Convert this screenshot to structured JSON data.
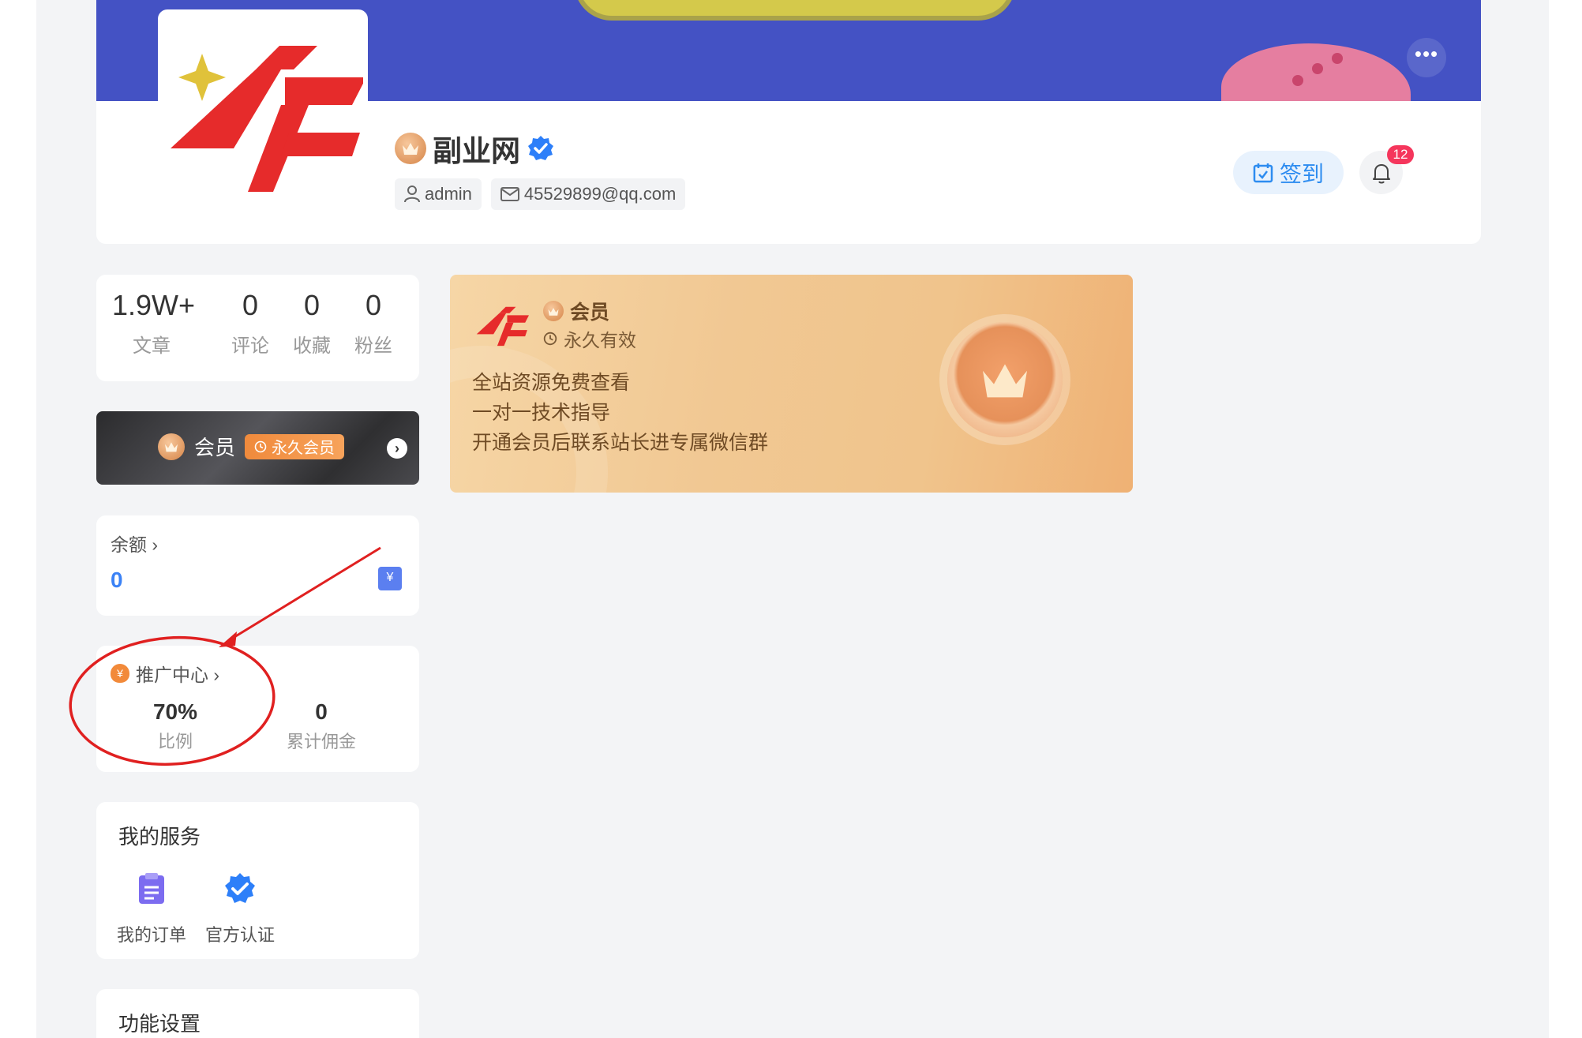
{
  "profile": {
    "name": "副业网",
    "username": "admin",
    "email": "45529899@qq.com",
    "checkin_label": "签到",
    "notification_count": "12",
    "more_label": "•••"
  },
  "stats": [
    {
      "value": "1.9W+",
      "label": "文章"
    },
    {
      "value": "0",
      "label": "评论"
    },
    {
      "value": "0",
      "label": "收藏"
    },
    {
      "value": "0",
      "label": "粉丝"
    }
  ],
  "vip_bar": {
    "label": "会员",
    "badge": "永久会员",
    "arrow": "›"
  },
  "balance": {
    "title": "余额 ›",
    "value": "0",
    "icon": "¥"
  },
  "promotion": {
    "title": "推广中心 ›",
    "rate_value": "70%",
    "rate_label": "比例",
    "commission_value": "0",
    "commission_label": "累计佣金"
  },
  "services": {
    "title": "我的服务",
    "items": [
      {
        "label": "我的订单",
        "icon": "clipboard-icon"
      },
      {
        "label": "官方认证",
        "icon": "verified-icon"
      }
    ]
  },
  "settings": {
    "title": "功能设置"
  },
  "vip_card": {
    "title": "会员",
    "validity": "永久有效",
    "perks": [
      "全站资源免费查看",
      "一对一技术指导",
      "开通会员后联系站长进专属微信群"
    ]
  },
  "colors": {
    "accent": "#2d8cf0",
    "banner": "#4452c4",
    "annotation": "#e02020",
    "balance": "#3b82f6"
  }
}
